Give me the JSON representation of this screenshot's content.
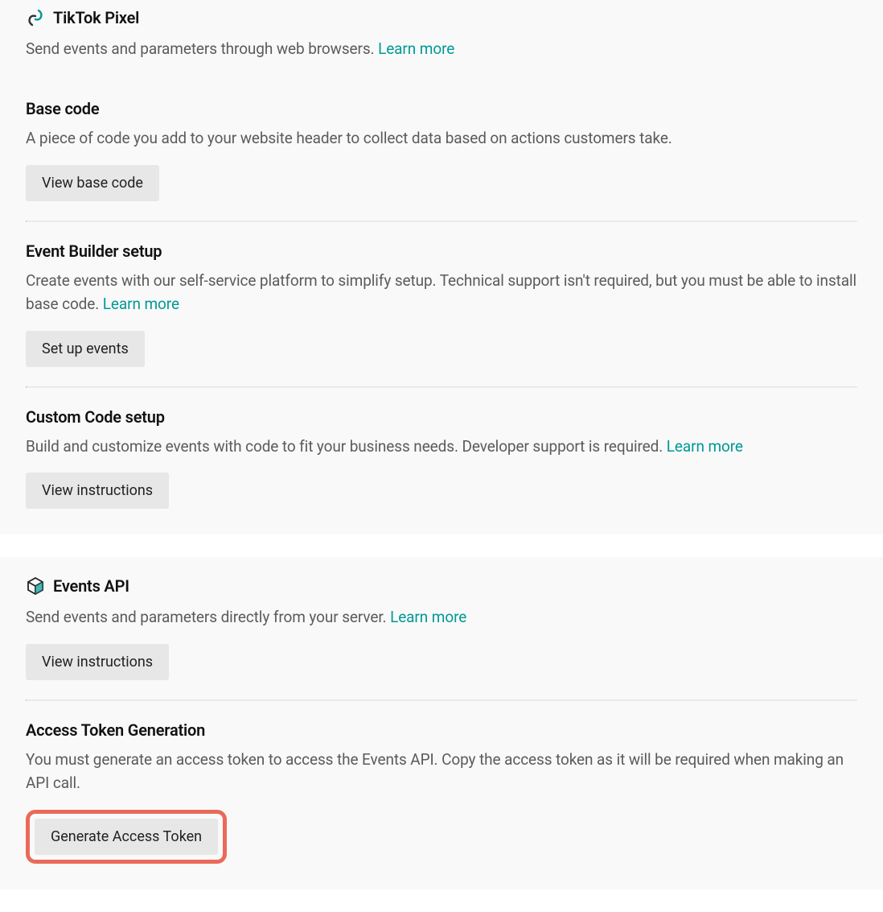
{
  "pixel": {
    "title": "TikTok Pixel",
    "desc": "Send events and parameters through web browsers. ",
    "learn_more": "Learn more",
    "base_code": {
      "heading": "Base code",
      "desc": "A piece of code you add to your website header to collect data based on actions customers take.",
      "button": "View base code"
    },
    "event_builder": {
      "heading": "Event Builder setup",
      "desc": "Create events with our self-service platform to simplify setup. Technical support isn't required, but you must be able to install base code. ",
      "learn_more": "Learn more",
      "button": "Set up events"
    },
    "custom_code": {
      "heading": "Custom Code setup",
      "desc": "Build and customize events with code to fit your business needs. Developer support is required. ",
      "learn_more": "Learn more",
      "button": "View instructions"
    }
  },
  "events_api": {
    "title": "Events API",
    "desc": "Send events and parameters directly from your server. ",
    "learn_more": "Learn more",
    "button": "View instructions",
    "access_token": {
      "heading": "Access Token Generation",
      "desc": "You must generate an access token to access the Events API. Copy the access token as it will be required when making an API call.",
      "button": "Generate Access Token"
    }
  }
}
